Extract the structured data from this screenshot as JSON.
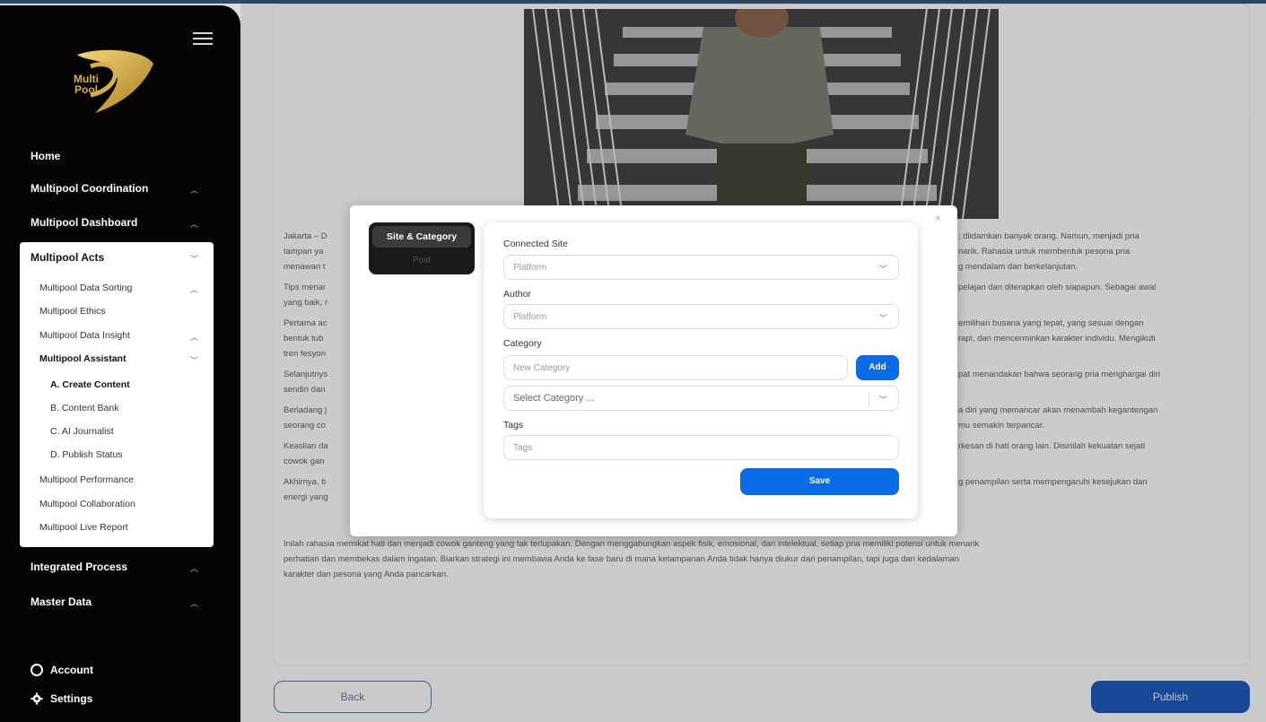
{
  "brand": {
    "logo_line1": "Multi",
    "logo_line2": "Pool"
  },
  "sidebar": {
    "top_items": [
      {
        "label": "Home"
      },
      {
        "label": "Multipool Coordination"
      },
      {
        "label": "Multipool Dashboard"
      }
    ],
    "acts": {
      "label": "Multipool Acts",
      "items": [
        {
          "label": "Multipool Data Sorting"
        },
        {
          "label": "Multipool Ethics"
        },
        {
          "label": "Multipool Data Insight"
        },
        {
          "label": "Multipool Assistant"
        },
        {
          "label": "A. Create Content"
        },
        {
          "label": "B. Content Bank"
        },
        {
          "label": "C. AI Journalist"
        },
        {
          "label": "D. Publish Status"
        },
        {
          "label": "Multipool Performance"
        },
        {
          "label": "Multipool Collaboration"
        },
        {
          "label": "Multipool Live Report"
        }
      ]
    },
    "bottom_items": [
      {
        "label": "Integrated Process"
      },
      {
        "label": "Master Data"
      }
    ],
    "footer": {
      "account": "Account",
      "settings": "Settings"
    }
  },
  "article": {
    "paragraphs_left": [
      "Jakarta – D",
      "tampan ya",
      "menawan t",
      "Tips menar",
      "yang baik, r",
      "Pertama ac",
      "bentuk tub",
      "tren fesyon",
      "Selanjutnys",
      "sendiri dan",
      "Berladang j",
      "seorang co",
      "Keaslian da",
      "cowok gan",
      "Akhirnya, ti",
      "energi yang"
    ],
    "paragraphs_right": [
      "; diidamkan banyak orang. Namun, menjadi pria",
      "narik. Rahasia untuk membentuk pesona pria",
      "g mendalam dan berkelanjutan.",
      "pelajari dan diterapkan oleh siapapun. Sebagai awal",
      "emilihan busana yang tepat, yang sesuai dengan",
      "rapi, dan mencerminkan karakter individu. Mengikuti",
      "pat menandakan bahwa seorang pria menghargai diri",
      "a diri yang memancar akan menambah kegantengan",
      "mu semakin terpancar.",
      "rkesan di hati orang lain. Disinilah kekuatan sejati",
      "g penampilan serta mempengaruhi kesejukan dan"
    ],
    "closing": [
      "Inilah rahasia memikat hati dan menjadi cowok ganteng yang tak terlupakan. Dengan menggabungkan aspek fisik, emosional, dan intelektual, setiap pria memiliki potensi untuk menarik",
      "perhatian dan membekas dalam ingatan. Biarkan strategi ini membawa Anda ke fase baru di mana ketampanan Anda tidak hanya diukur dari penampilan, tapi juga dari kedalaman",
      "karakter dan pesona yang Anda pancarkan."
    ]
  },
  "actions": {
    "back": "Back",
    "publish": "Publish"
  },
  "modal": {
    "close": "×",
    "tabs": {
      "active": "Site & Category",
      "inactive": "Post"
    },
    "connected_site": {
      "label": "Connected Site",
      "placeholder": "Platform"
    },
    "author": {
      "label": "Author",
      "placeholder": "Platform"
    },
    "category": {
      "label": "Category",
      "new_placeholder": "New Category",
      "add": "Add",
      "select_placeholder": "Select Category ..."
    },
    "tags": {
      "label": "Tags",
      "placeholder": "Tags"
    },
    "save": "Save"
  },
  "colors": {
    "accent": "#0a6be8",
    "sidebar": "#050505",
    "gold": "#d4b04a",
    "publish": "#1c4fa3"
  }
}
